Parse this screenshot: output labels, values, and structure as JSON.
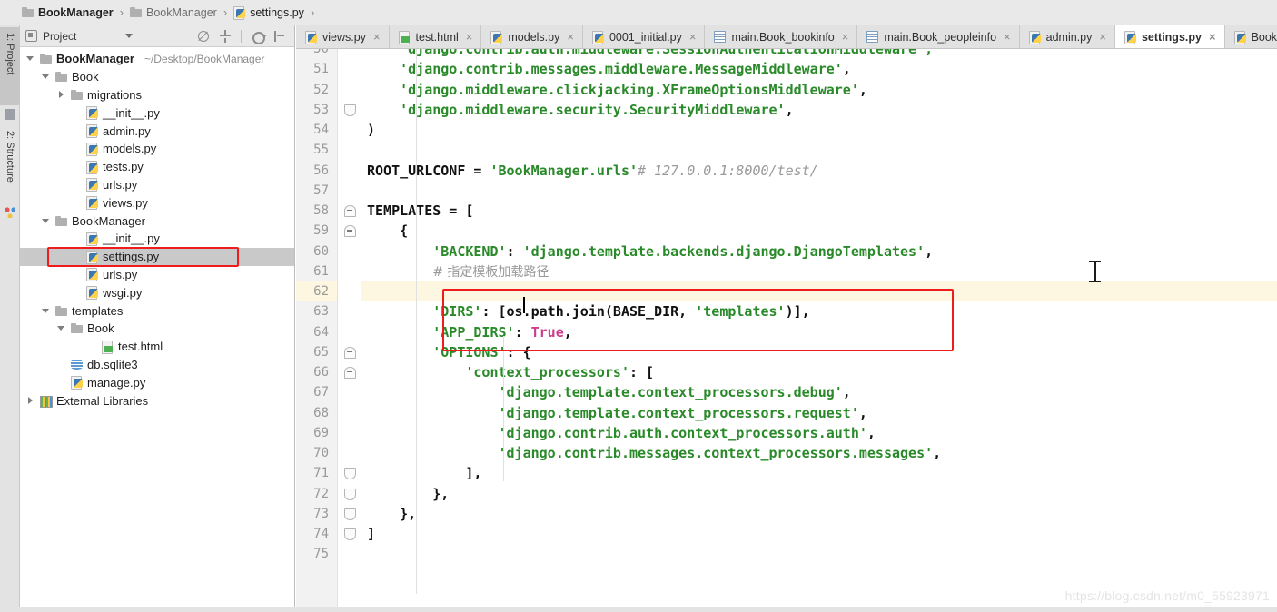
{
  "window": {
    "ide": "PyCharm",
    "watermark": "https://blog.csdn.net/m0_55923971"
  },
  "breadcrumb": {
    "items": [
      {
        "label": "BookManager",
        "icon": "folder-icon",
        "style": "bold"
      },
      {
        "label": "BookManager",
        "icon": "folder-icon",
        "style": "dim"
      },
      {
        "label": "settings.py",
        "icon": "python-file-icon",
        "style": "normal"
      }
    ],
    "separator": "›"
  },
  "tool_strip": {
    "tabs": [
      {
        "label": "1: Project",
        "icon": "project-icon",
        "active": true
      },
      {
        "label": "2: Structure",
        "icon": "structure-icon",
        "active": false
      }
    ]
  },
  "project_panel": {
    "title": "Project",
    "dropdown_caret": "caret-down-icon",
    "tools": [
      {
        "name": "locate-target-icon",
        "title": "Select Opened File"
      },
      {
        "name": "collapse-all-icon",
        "title": "Collapse All"
      },
      {
        "name": "gear-icon",
        "title": "Settings"
      },
      {
        "name": "hide-panel-icon",
        "title": "Hide"
      }
    ],
    "tree": [
      {
        "label": "BookManager",
        "path": "~/Desktop/BookManager",
        "icon": "folder-icon",
        "indent": 0,
        "arrow": "down",
        "bold": true,
        "selected": false
      },
      {
        "label": "Book",
        "icon": "folder-icon",
        "indent": 1,
        "arrow": "down",
        "bold": false,
        "selected": false
      },
      {
        "label": "migrations",
        "icon": "folder-icon",
        "indent": 2,
        "arrow": "right",
        "bold": false,
        "selected": false
      },
      {
        "label": "__init__.py",
        "icon": "python-file-icon",
        "indent": 3,
        "arrow": "none",
        "bold": false,
        "selected": false
      },
      {
        "label": "admin.py",
        "icon": "python-file-icon",
        "indent": 3,
        "arrow": "none",
        "bold": false,
        "selected": false
      },
      {
        "label": "models.py",
        "icon": "python-file-icon",
        "indent": 3,
        "arrow": "none",
        "bold": false,
        "selected": false
      },
      {
        "label": "tests.py",
        "icon": "python-file-icon",
        "indent": 3,
        "arrow": "none",
        "bold": false,
        "selected": false
      },
      {
        "label": "urls.py",
        "icon": "python-file-icon",
        "indent": 3,
        "arrow": "none",
        "bold": false,
        "selected": false
      },
      {
        "label": "views.py",
        "icon": "python-file-icon",
        "indent": 3,
        "arrow": "none",
        "bold": false,
        "selected": false
      },
      {
        "label": "BookManager",
        "icon": "folder-icon",
        "indent": 1,
        "arrow": "down",
        "bold": false,
        "selected": false
      },
      {
        "label": "__init__.py",
        "icon": "python-file-icon",
        "indent": 3,
        "arrow": "none",
        "bold": false,
        "selected": false
      },
      {
        "label": "settings.py",
        "icon": "python-file-icon",
        "indent": 3,
        "arrow": "none",
        "bold": false,
        "selected": true
      },
      {
        "label": "urls.py",
        "icon": "python-file-icon",
        "indent": 3,
        "arrow": "none",
        "bold": false,
        "selected": false
      },
      {
        "label": "wsgi.py",
        "icon": "python-file-icon",
        "indent": 3,
        "arrow": "none",
        "bold": false,
        "selected": false
      },
      {
        "label": "templates",
        "icon": "folder-icon",
        "indent": 1,
        "arrow": "down",
        "bold": false,
        "selected": false
      },
      {
        "label": "Book",
        "icon": "folder-icon",
        "indent": 2,
        "arrow": "down",
        "bold": false,
        "selected": false
      },
      {
        "label": "test.html",
        "icon": "html-file-icon",
        "indent": 4,
        "arrow": "none",
        "bold": false,
        "selected": false
      },
      {
        "label": "db.sqlite3",
        "icon": "database-icon",
        "indent": 2,
        "arrow": "none",
        "bold": false,
        "selected": false
      },
      {
        "label": "manage.py",
        "icon": "python-file-icon",
        "indent": 2,
        "arrow": "none",
        "bold": false,
        "selected": false
      },
      {
        "label": "External Libraries",
        "icon": "libraries-icon",
        "indent": 0,
        "arrow": "right",
        "bold": false,
        "selected": false
      }
    ]
  },
  "editor": {
    "tabs": [
      {
        "label": "views.py",
        "icon": "python-file-icon",
        "active": false
      },
      {
        "label": "test.html",
        "icon": "html-file-icon",
        "active": false
      },
      {
        "label": "models.py",
        "icon": "python-file-icon",
        "active": false
      },
      {
        "label": "0001_initial.py",
        "icon": "python-file-icon",
        "active": false
      },
      {
        "label": "main.Book_bookinfo",
        "icon": "table-icon",
        "active": false
      },
      {
        "label": "main.Book_peopleinfo",
        "icon": "table-icon",
        "active": false
      },
      {
        "label": "admin.py",
        "icon": "python-file-icon",
        "active": false
      },
      {
        "label": "settings.py",
        "icon": "python-file-icon",
        "active": true
      },
      {
        "label": "BookManager/u",
        "icon": "python-file-icon",
        "active": false
      }
    ],
    "close_glyph": "×",
    "current_line": 62,
    "highlight_color": "#fdf6e0",
    "annotation_box_color": "#ee1c1c",
    "first_visible_line": 50,
    "last_visible_line": 75,
    "lines": [
      {
        "n": 50,
        "clipped": true,
        "tokens": [
          {
            "t": "    ",
            "c": "plain"
          },
          {
            "t": "'django.contrib.auth.middleware.SessionAuthenticationMiddleware',",
            "c": "str"
          }
        ]
      },
      {
        "n": 51,
        "tokens": [
          {
            "t": "    ",
            "c": "plain"
          },
          {
            "t": "'django.contrib.messages.middleware.MessageMiddleware'",
            "c": "str"
          },
          {
            "t": ",",
            "c": "plain"
          }
        ]
      },
      {
        "n": 52,
        "tokens": [
          {
            "t": "    ",
            "c": "plain"
          },
          {
            "t": "'django.middleware.clickjacking.XFrameOptionsMiddleware'",
            "c": "str"
          },
          {
            "t": ",",
            "c": "plain"
          }
        ]
      },
      {
        "n": 53,
        "fold": "cap",
        "tokens": [
          {
            "t": "    ",
            "c": "plain"
          },
          {
            "t": "'django.middleware.security.SecurityMiddleware'",
            "c": "str"
          },
          {
            "t": ",",
            "c": "plain"
          }
        ]
      },
      {
        "n": 54,
        "tokens": [
          {
            "t": ")",
            "c": "plain"
          }
        ]
      },
      {
        "n": 55,
        "tokens": []
      },
      {
        "n": 56,
        "tokens": [
          {
            "t": "ROOT_URLCONF = ",
            "c": "plain"
          },
          {
            "t": "'BookManager.urls'",
            "c": "str"
          },
          {
            "t": "# 127.0.0.1:8000/test/",
            "c": "cmt"
          }
        ]
      },
      {
        "n": 57,
        "tokens": []
      },
      {
        "n": 58,
        "fold": "capup",
        "tokens": [
          {
            "t": "TEMPLATES = [",
            "c": "plain"
          }
        ]
      },
      {
        "n": 59,
        "fold": "capup",
        "tokens": [
          {
            "t": "    {",
            "c": "plain"
          }
        ]
      },
      {
        "n": 60,
        "tokens": [
          {
            "t": "        ",
            "c": "plain"
          },
          {
            "t": "'BACKEND'",
            "c": "str"
          },
          {
            "t": ": ",
            "c": "plain"
          },
          {
            "t": "'django.template.backends.django.DjangoTemplates'",
            "c": "str"
          },
          {
            "t": ",",
            "c": "plain"
          }
        ]
      },
      {
        "n": 61,
        "tokens": [
          {
            "t": "        ",
            "c": "plain"
          },
          {
            "t": "# 指定模板加载路径",
            "c": "cmt-cn"
          }
        ]
      },
      {
        "n": 62,
        "highlight": true,
        "caret": true,
        "tokens": [
          {
            "t": "        ",
            "c": "plain"
          }
        ]
      },
      {
        "n": 63,
        "tokens": [
          {
            "t": "        ",
            "c": "plain"
          },
          {
            "t": "'DIRS'",
            "c": "str"
          },
          {
            "t": ": [os.path.join(BASE_DIR, ",
            "c": "plain"
          },
          {
            "t": "'templates'",
            "c": "str"
          },
          {
            "t": ")],",
            "c": "plain"
          }
        ]
      },
      {
        "n": 64,
        "tokens": [
          {
            "t": "        ",
            "c": "plain"
          },
          {
            "t": "'APP_DIRS'",
            "c": "str"
          },
          {
            "t": ": ",
            "c": "plain"
          },
          {
            "t": "True",
            "c": "kw"
          },
          {
            "t": ",",
            "c": "plain"
          }
        ]
      },
      {
        "n": 65,
        "fold": "capup",
        "tokens": [
          {
            "t": "        ",
            "c": "plain"
          },
          {
            "t": "'OPTIONS'",
            "c": "str"
          },
          {
            "t": ": {",
            "c": "plain"
          }
        ]
      },
      {
        "n": 66,
        "fold": "capup",
        "tokens": [
          {
            "t": "            ",
            "c": "plain"
          },
          {
            "t": "'context_processors'",
            "c": "str"
          },
          {
            "t": ": [",
            "c": "plain"
          }
        ]
      },
      {
        "n": 67,
        "tokens": [
          {
            "t": "                ",
            "c": "plain"
          },
          {
            "t": "'django.template.context_processors.debug'",
            "c": "str"
          },
          {
            "t": ",",
            "c": "plain"
          }
        ]
      },
      {
        "n": 68,
        "tokens": [
          {
            "t": "                ",
            "c": "plain"
          },
          {
            "t": "'django.template.context_processors.request'",
            "c": "str"
          },
          {
            "t": ",",
            "c": "plain"
          }
        ]
      },
      {
        "n": 69,
        "tokens": [
          {
            "t": "                ",
            "c": "plain"
          },
          {
            "t": "'django.contrib.auth.context_processors.auth'",
            "c": "str"
          },
          {
            "t": ",",
            "c": "plain"
          }
        ]
      },
      {
        "n": 70,
        "tokens": [
          {
            "t": "                ",
            "c": "plain"
          },
          {
            "t": "'django.contrib.messages.context_processors.messages'",
            "c": "str"
          },
          {
            "t": ",",
            "c": "plain"
          }
        ]
      },
      {
        "n": 71,
        "fold": "cap",
        "tokens": [
          {
            "t": "            ],",
            "c": "plain"
          }
        ]
      },
      {
        "n": 72,
        "fold": "cap",
        "tokens": [
          {
            "t": "        },",
            "c": "plain"
          }
        ]
      },
      {
        "n": 73,
        "fold": "cap",
        "tokens": [
          {
            "t": "    },",
            "c": "plain"
          }
        ]
      },
      {
        "n": 74,
        "fold": "cap",
        "tokens": [
          {
            "t": "]",
            "c": "plain"
          }
        ]
      },
      {
        "n": 75,
        "tokens": []
      }
    ]
  }
}
